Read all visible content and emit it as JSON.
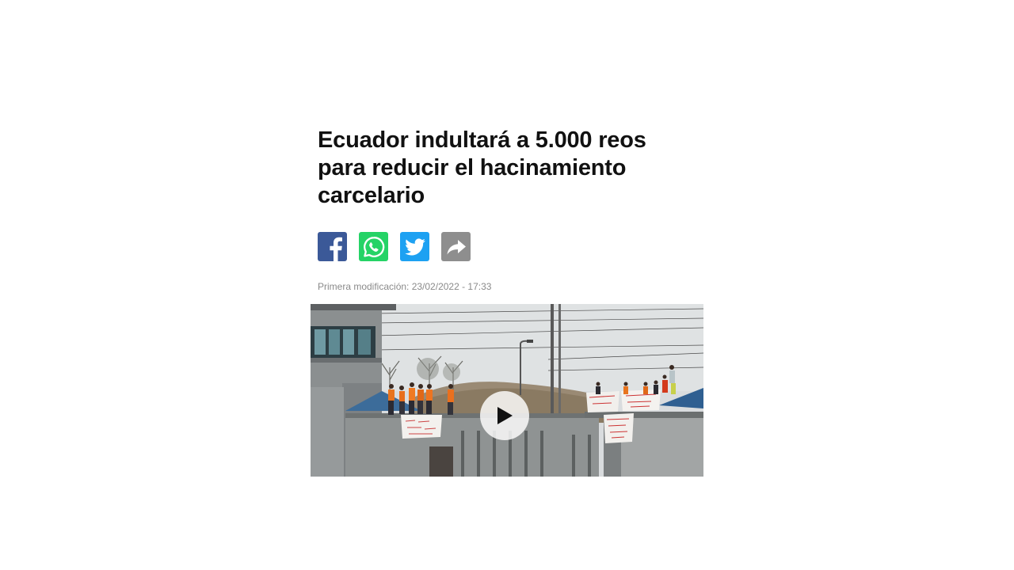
{
  "article": {
    "headline": "Ecuador indultará a 5.000 reos para reducir el hacinamiento carcelario",
    "meta": "Primera modificación: 23/02/2022 - 17:33"
  },
  "share": [
    {
      "network": "facebook",
      "icon": "facebook-icon",
      "color": "#3b5998"
    },
    {
      "network": "whatsapp",
      "icon": "whatsapp-icon",
      "color": "#25d366"
    },
    {
      "network": "twitter",
      "icon": "twitter-icon",
      "color": "#1da1f2"
    },
    {
      "network": "share",
      "icon": "share-arrow-icon",
      "color": "#8e8e8e"
    }
  ],
  "media": {
    "type": "video",
    "icon": "play-icon"
  }
}
